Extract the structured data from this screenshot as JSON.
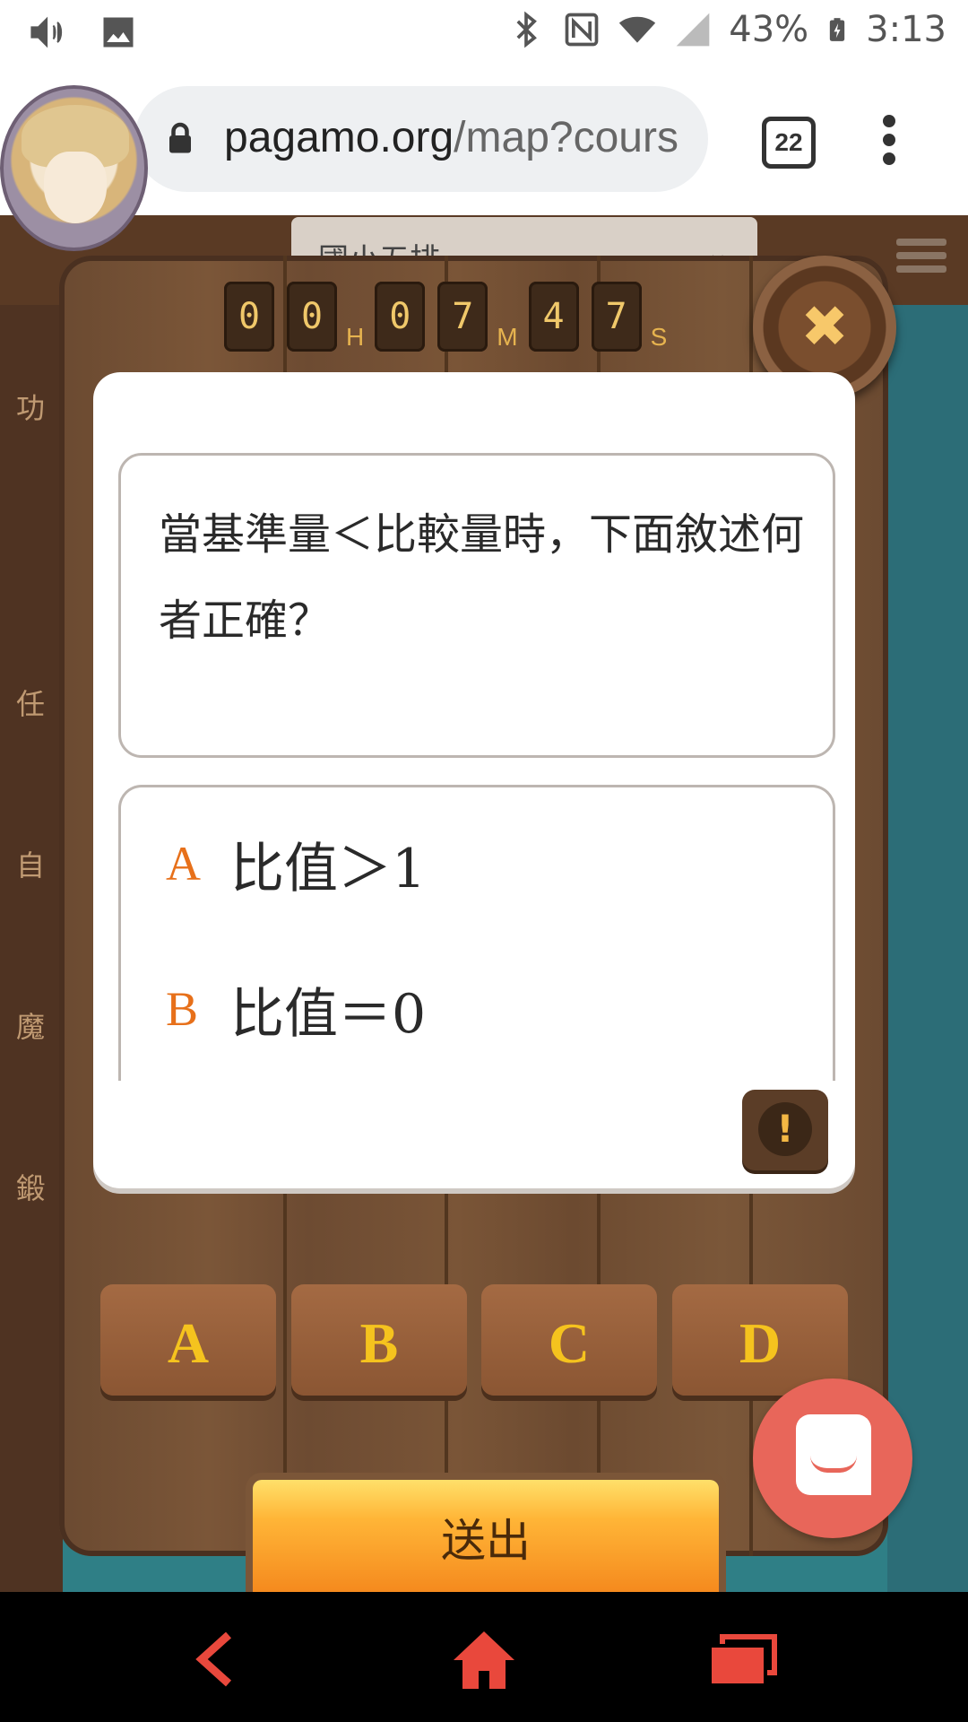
{
  "status_bar": {
    "battery": "43%",
    "time": "3:13",
    "icons": [
      "volume-icon",
      "gallery-icon",
      "bluetooth-icon",
      "nfc-icon",
      "wifi-icon",
      "signal-icon",
      "battery-charging-icon"
    ]
  },
  "browser": {
    "url_domain": "pagamo.org",
    "url_path": "/map?cours",
    "tab_count": "22"
  },
  "game": {
    "side_labels": [
      "功",
      "任",
      "自",
      "魔",
      "鍛"
    ],
    "course_dropdown": "國小五排"
  },
  "timer": {
    "hours": [
      "0",
      "0"
    ],
    "minutes": [
      "0",
      "7"
    ],
    "seconds": [
      "4",
      "7"
    ],
    "unit_h": "H",
    "unit_m": "M",
    "unit_s": "S"
  },
  "question": {
    "text": "當基準量＜比較量時，下面敘述何者正確？"
  },
  "options": [
    {
      "letter": "A",
      "text": "比值＞1"
    },
    {
      "letter": "B",
      "text": "比值＝0"
    }
  ],
  "answers": [
    "A",
    "B",
    "C",
    "D"
  ],
  "submit_label": "送出",
  "colors": {
    "option_letter": "#e7701a",
    "answer_text": "#f5c31e",
    "chat_bg": "#e8665a",
    "nav_icon": "#e9483c"
  }
}
